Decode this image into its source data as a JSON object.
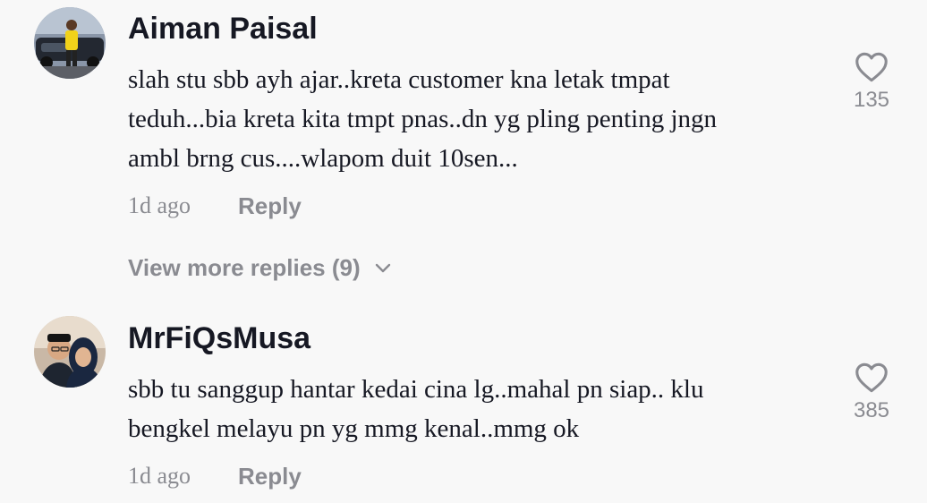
{
  "comments": [
    {
      "username": "Aiman Paisal",
      "text_lines": [
        "slah stu sbb ayh ajar..kreta customer kna letak tmpat",
        "teduh...bia kreta kita tmpt pnas..dn yg pling penting jngn",
        "ambl brng cus....wlapom duit 10sen..."
      ],
      "time": "1d ago",
      "reply_label": "Reply",
      "like_count": "135",
      "like_icon": "heart-outline-icon"
    },
    {
      "username": "MrFiQsMusa",
      "text_lines": [
        "sbb tu sanggup hantar kedai cina lg..mahal pn siap.. klu",
        "bengkel melayu pn yg mmg kenal..mmg ok"
      ],
      "time": "1d ago",
      "reply_label": "Reply",
      "like_count": "385",
      "like_icon": "heart-outline-icon"
    }
  ],
  "view_more_replies": {
    "label": "View more replies (9)",
    "icon": "chevron-down-icon"
  },
  "colors": {
    "background": "#f8f8f8",
    "primary_text": "#161823",
    "secondary_text": "#8a8b91"
  }
}
